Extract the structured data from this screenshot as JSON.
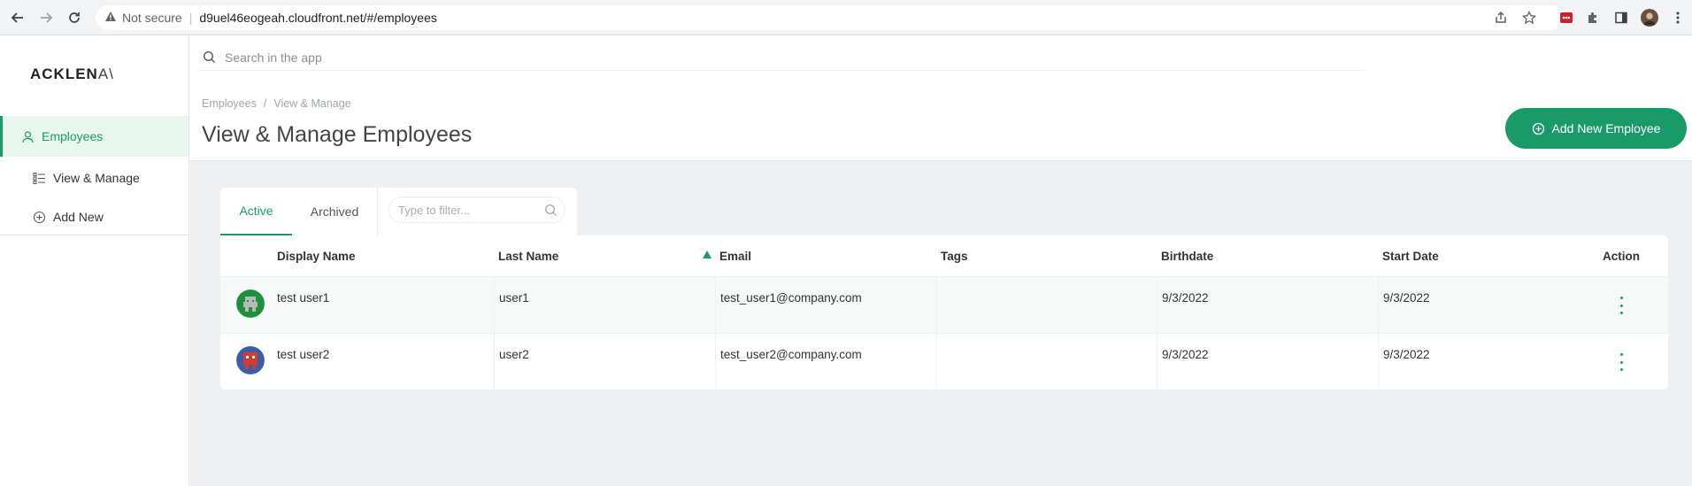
{
  "browser": {
    "not_secure_label": "Not secure",
    "url": "d9uel46eogeah.cloudfront.net/#/employees",
    "icons": [
      "back-arrow-icon",
      "forward-arrow-icon",
      "reload-icon",
      "warning-icon",
      "share-icon",
      "star-icon",
      "extension-lastpass-icon",
      "puzzle-icon",
      "sidepanel-icon",
      "profile-avatar-icon",
      "kebab-menu-icon"
    ]
  },
  "sidebar": {
    "logo_main": "ACKLEN",
    "logo_accent": "A\\",
    "items": [
      {
        "label": "Employees",
        "icon": "user-icon",
        "active": true
      },
      {
        "label": "View & Manage",
        "icon": "list-icon",
        "active": false
      },
      {
        "label": "Add New",
        "icon": "plus-circle-icon",
        "active": false
      }
    ]
  },
  "header": {
    "search_placeholder": "Search in the app",
    "breadcrumb": [
      "Employees",
      "View & Manage"
    ],
    "breadcrumb_separator": "/",
    "title": "View & Manage Employees",
    "add_button_label": "Add New Employee"
  },
  "tabs": {
    "items": [
      {
        "label": "Active",
        "active": true
      },
      {
        "label": "Archived",
        "active": false
      }
    ],
    "filter_placeholder": "Type to filter..."
  },
  "table": {
    "columns": [
      "Display Name",
      "Last Name",
      "Email",
      "Tags",
      "Birthdate",
      "Start Date",
      "Action"
    ],
    "sorted_column": "Email",
    "rows": [
      {
        "display_name": "test user1",
        "last_name": "user1",
        "email": "test_user1@company.com",
        "tags": "",
        "birthdate": "9/3/2022",
        "start_date": "9/3/2022",
        "avatar": "green-pixel-avatar"
      },
      {
        "display_name": "test user2",
        "last_name": "user2",
        "email": "test_user2@company.com",
        "tags": "",
        "birthdate": "9/3/2022",
        "start_date": "9/3/2022",
        "avatar": "red-pixel-avatar"
      }
    ]
  },
  "colors": {
    "accent": "#1a9a69",
    "background": "#eef0f1",
    "sidebar_active_bg": "#e8f6f0"
  }
}
